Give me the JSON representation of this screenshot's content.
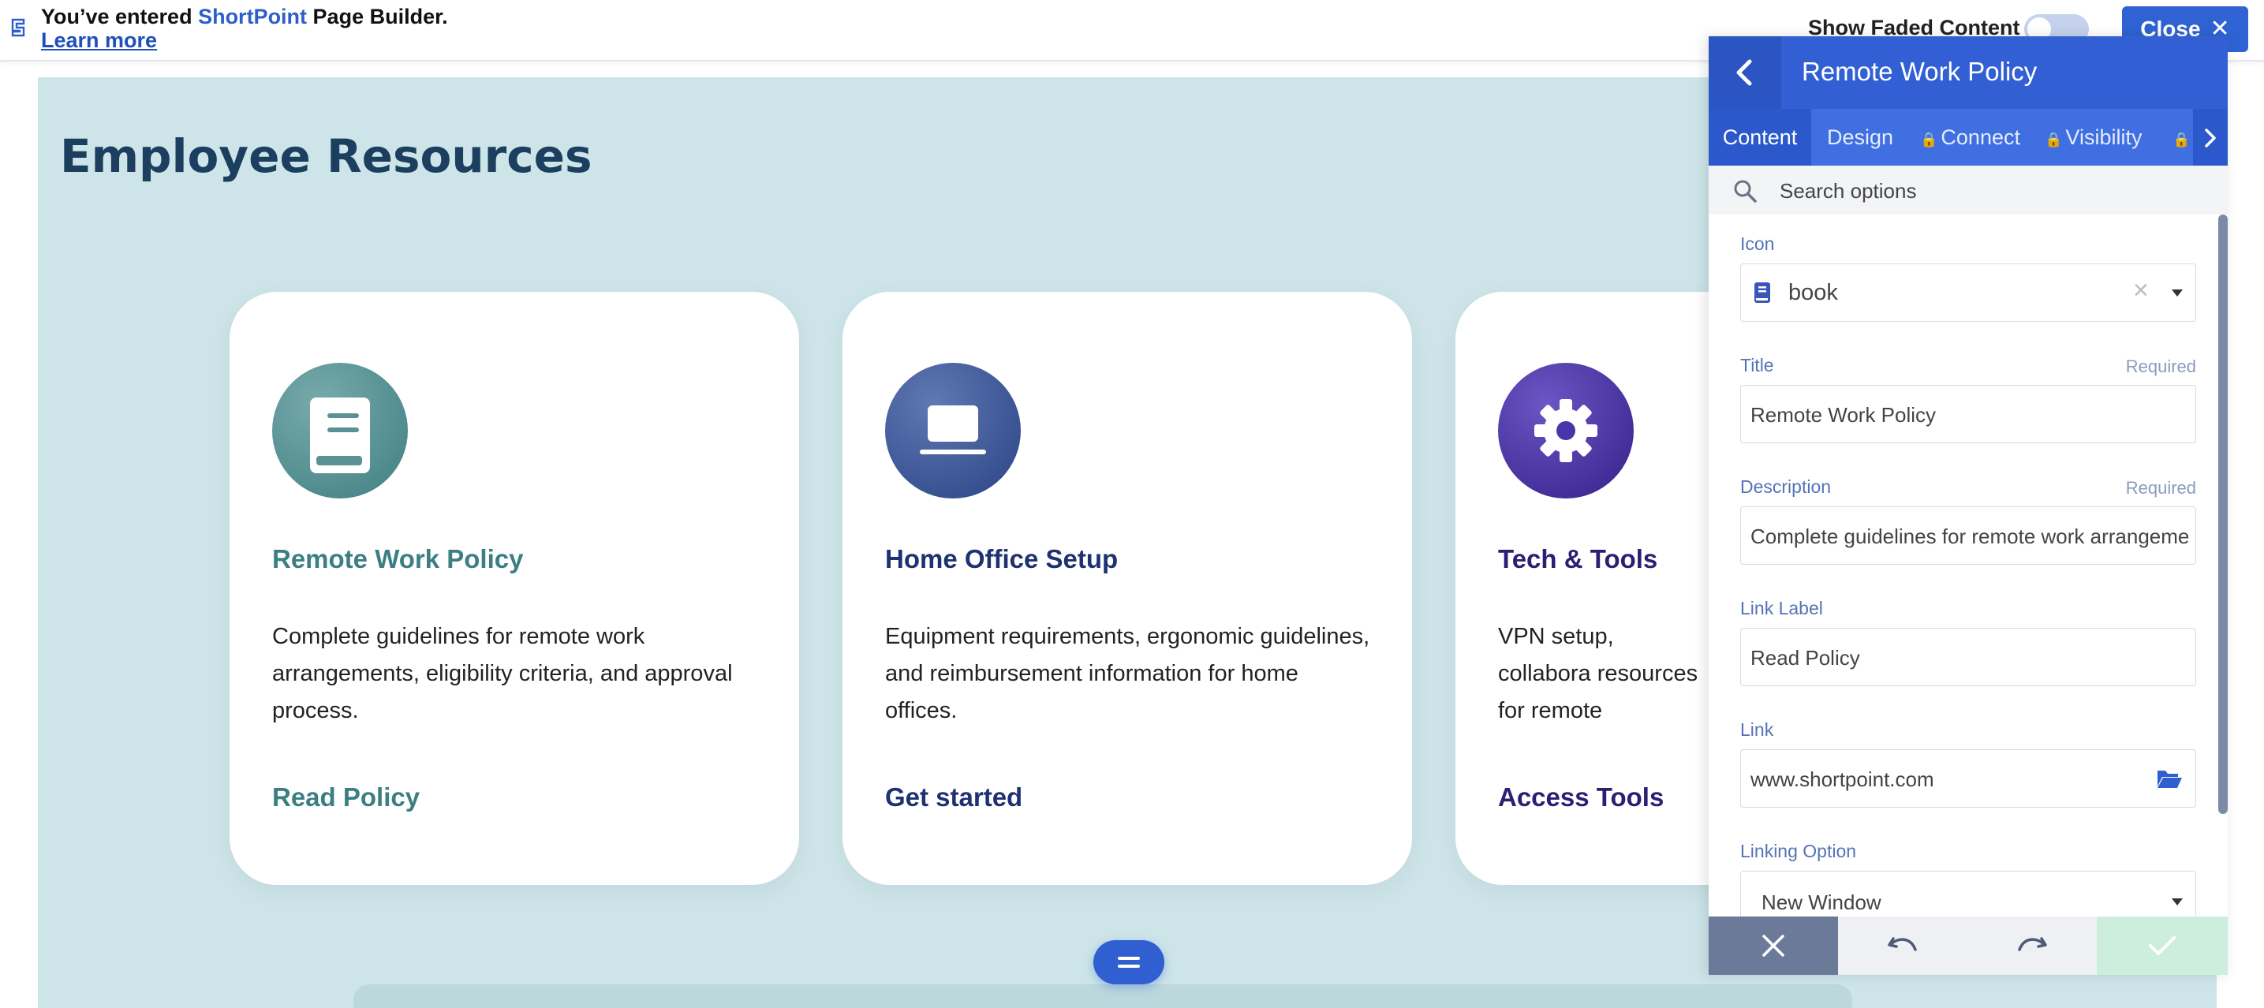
{
  "notice": {
    "prefix": "You’ve entered ",
    "brand": "ShortPoint",
    "suffix": " Page Builder.",
    "learn_more": "Learn more"
  },
  "top_controls": {
    "show_faded_label": "Show Faded Content",
    "show_faded_on": false,
    "close_label": "Close"
  },
  "page": {
    "heading": "Employee Resources",
    "cards": [
      {
        "icon": "book-icon",
        "title": "Remote Work Policy",
        "description": "Complete guidelines for remote work arrangements, eligibility criteria, and approval process.",
        "link_label": "Read Policy",
        "accent": "#3b7f82"
      },
      {
        "icon": "laptop-icon",
        "title": "Home Office Setup",
        "description": "Equipment requirements, ergonomic guidelines, and reimbursement information for home offices.",
        "link_label": "Get started",
        "accent": "#1e3171"
      },
      {
        "icon": "gear-icon",
        "title": "Tech & Tools",
        "description": "VPN setup, collabora resources for remote",
        "link_label": "Access Tools",
        "accent": "#2a1f73"
      }
    ]
  },
  "panel": {
    "title": "Remote Work Policy",
    "tabs": [
      {
        "label": "Content",
        "locked": false
      },
      {
        "label": "Design",
        "locked": false
      },
      {
        "label": "Connect",
        "locked": true
      },
      {
        "label": "Visibility",
        "locked": true
      }
    ],
    "search_placeholder": "Search options",
    "fields": {
      "icon_label": "Icon",
      "icon_value": "book",
      "title_label": "Title",
      "title_value": "Remote Work Policy",
      "required": "Required",
      "description_label": "Description",
      "description_value": "Complete guidelines for remote work arrangements, eligibility criteria, and approval process.",
      "link_label_label": "Link Label",
      "link_label_value": "Read Policy",
      "link_label": "Link",
      "link_value": "www.shortpoint.com",
      "linking_option_label": "Linking Option",
      "linking_option_value": "New Window"
    }
  },
  "colors": {
    "primary": "#3260d4",
    "canvas_bg": "#cde5e9",
    "heading": "#1d3f5f",
    "footer_cancel": "#6c7a99",
    "footer_confirm": "#cdeedd"
  }
}
